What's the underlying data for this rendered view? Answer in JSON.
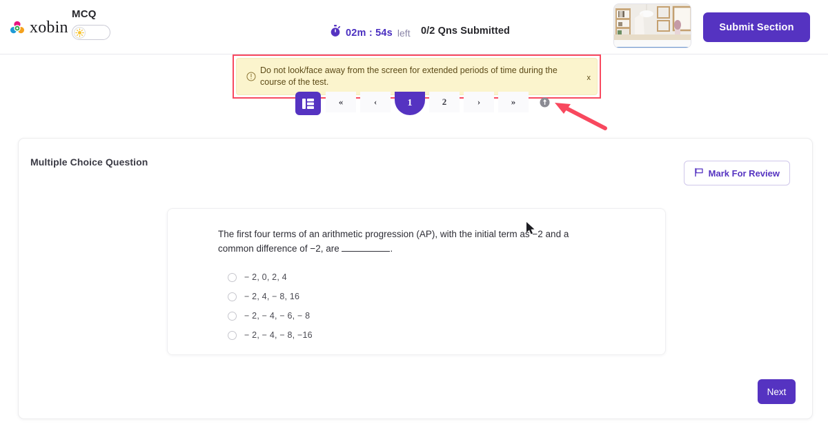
{
  "header": {
    "brand_name": "xobin",
    "brand_logo_icon": "xobin-flower-logo",
    "mode_label": "MCQ",
    "mode_toggle_icon": "sun-icon",
    "timer_icon": "stopwatch-icon",
    "timer_value": "02m : 54s",
    "timer_suffix": "left",
    "questions_submitted": "0/2 Qns Submitted",
    "webcam_icon": "webcam-preview",
    "submit_section_label": "Submit Section"
  },
  "banner": {
    "icon": "info-circle-icon",
    "message": "Do not look/face away from the screen for extended periods of time during the course of the test.",
    "close_label": "x"
  },
  "pagination": {
    "list_icon": "question-list-icon",
    "first_label": "«",
    "prev_label": "‹",
    "pages": [
      "1",
      "2"
    ],
    "active_page": "1",
    "next_label": "›",
    "last_label": "»",
    "info_icon": "info-badge-icon"
  },
  "question_panel": {
    "type_label": "Multiple Choice Question",
    "mark_for_review_label": "Mark For Review",
    "mark_for_review_icon": "flag-icon",
    "question_line1": "The first four terms of an arithmetic progression (AP), with the initial term as −2 and a",
    "question_line2_pre": "common difference of −2, are ",
    "question_line2_post": ".",
    "options": [
      "− 2, 0, 2, 4",
      "− 2, 4, − 8, 16",
      "− 2, − 4, − 6, − 8",
      "− 2, − 4, − 8, −16"
    ],
    "selected_option": null,
    "next_label": "Next"
  },
  "annotations": {
    "arrow_icon": "red-arrow-pointing-to-pagination",
    "arrow_color": "#f8485e",
    "highlight_box_color": "#f8485e"
  },
  "colors": {
    "brand_purple": "#5533c1",
    "banner_bg": "#fbf4cd",
    "banner_text": "#5c4a17",
    "page_bg": "#ffffff"
  }
}
